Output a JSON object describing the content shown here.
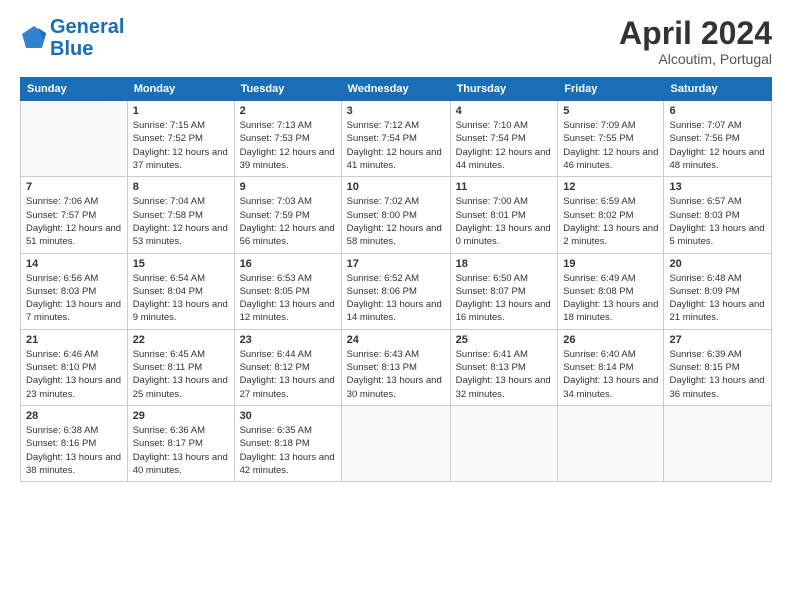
{
  "header": {
    "logo_line1": "General",
    "logo_line2": "Blue",
    "month_title": "April 2024",
    "subtitle": "Alcoutim, Portugal"
  },
  "weekdays": [
    "Sunday",
    "Monday",
    "Tuesday",
    "Wednesday",
    "Thursday",
    "Friday",
    "Saturday"
  ],
  "weeks": [
    [
      {
        "day": "",
        "sunrise": "",
        "sunset": "",
        "daylight": ""
      },
      {
        "day": "1",
        "sunrise": "Sunrise: 7:15 AM",
        "sunset": "Sunset: 7:52 PM",
        "daylight": "Daylight: 12 hours and 37 minutes."
      },
      {
        "day": "2",
        "sunrise": "Sunrise: 7:13 AM",
        "sunset": "Sunset: 7:53 PM",
        "daylight": "Daylight: 12 hours and 39 minutes."
      },
      {
        "day": "3",
        "sunrise": "Sunrise: 7:12 AM",
        "sunset": "Sunset: 7:54 PM",
        "daylight": "Daylight: 12 hours and 41 minutes."
      },
      {
        "day": "4",
        "sunrise": "Sunrise: 7:10 AM",
        "sunset": "Sunset: 7:54 PM",
        "daylight": "Daylight: 12 hours and 44 minutes."
      },
      {
        "day": "5",
        "sunrise": "Sunrise: 7:09 AM",
        "sunset": "Sunset: 7:55 PM",
        "daylight": "Daylight: 12 hours and 46 minutes."
      },
      {
        "day": "6",
        "sunrise": "Sunrise: 7:07 AM",
        "sunset": "Sunset: 7:56 PM",
        "daylight": "Daylight: 12 hours and 48 minutes."
      }
    ],
    [
      {
        "day": "7",
        "sunrise": "Sunrise: 7:06 AM",
        "sunset": "Sunset: 7:57 PM",
        "daylight": "Daylight: 12 hours and 51 minutes."
      },
      {
        "day": "8",
        "sunrise": "Sunrise: 7:04 AM",
        "sunset": "Sunset: 7:58 PM",
        "daylight": "Daylight: 12 hours and 53 minutes."
      },
      {
        "day": "9",
        "sunrise": "Sunrise: 7:03 AM",
        "sunset": "Sunset: 7:59 PM",
        "daylight": "Daylight: 12 hours and 56 minutes."
      },
      {
        "day": "10",
        "sunrise": "Sunrise: 7:02 AM",
        "sunset": "Sunset: 8:00 PM",
        "daylight": "Daylight: 12 hours and 58 minutes."
      },
      {
        "day": "11",
        "sunrise": "Sunrise: 7:00 AM",
        "sunset": "Sunset: 8:01 PM",
        "daylight": "Daylight: 13 hours and 0 minutes."
      },
      {
        "day": "12",
        "sunrise": "Sunrise: 6:59 AM",
        "sunset": "Sunset: 8:02 PM",
        "daylight": "Daylight: 13 hours and 2 minutes."
      },
      {
        "day": "13",
        "sunrise": "Sunrise: 6:57 AM",
        "sunset": "Sunset: 8:03 PM",
        "daylight": "Daylight: 13 hours and 5 minutes."
      }
    ],
    [
      {
        "day": "14",
        "sunrise": "Sunrise: 6:56 AM",
        "sunset": "Sunset: 8:03 PM",
        "daylight": "Daylight: 13 hours and 7 minutes."
      },
      {
        "day": "15",
        "sunrise": "Sunrise: 6:54 AM",
        "sunset": "Sunset: 8:04 PM",
        "daylight": "Daylight: 13 hours and 9 minutes."
      },
      {
        "day": "16",
        "sunrise": "Sunrise: 6:53 AM",
        "sunset": "Sunset: 8:05 PM",
        "daylight": "Daylight: 13 hours and 12 minutes."
      },
      {
        "day": "17",
        "sunrise": "Sunrise: 6:52 AM",
        "sunset": "Sunset: 8:06 PM",
        "daylight": "Daylight: 13 hours and 14 minutes."
      },
      {
        "day": "18",
        "sunrise": "Sunrise: 6:50 AM",
        "sunset": "Sunset: 8:07 PM",
        "daylight": "Daylight: 13 hours and 16 minutes."
      },
      {
        "day": "19",
        "sunrise": "Sunrise: 6:49 AM",
        "sunset": "Sunset: 8:08 PM",
        "daylight": "Daylight: 13 hours and 18 minutes."
      },
      {
        "day": "20",
        "sunrise": "Sunrise: 6:48 AM",
        "sunset": "Sunset: 8:09 PM",
        "daylight": "Daylight: 13 hours and 21 minutes."
      }
    ],
    [
      {
        "day": "21",
        "sunrise": "Sunrise: 6:46 AM",
        "sunset": "Sunset: 8:10 PM",
        "daylight": "Daylight: 13 hours and 23 minutes."
      },
      {
        "day": "22",
        "sunrise": "Sunrise: 6:45 AM",
        "sunset": "Sunset: 8:11 PM",
        "daylight": "Daylight: 13 hours and 25 minutes."
      },
      {
        "day": "23",
        "sunrise": "Sunrise: 6:44 AM",
        "sunset": "Sunset: 8:12 PM",
        "daylight": "Daylight: 13 hours and 27 minutes."
      },
      {
        "day": "24",
        "sunrise": "Sunrise: 6:43 AM",
        "sunset": "Sunset: 8:13 PM",
        "daylight": "Daylight: 13 hours and 30 minutes."
      },
      {
        "day": "25",
        "sunrise": "Sunrise: 6:41 AM",
        "sunset": "Sunset: 8:13 PM",
        "daylight": "Daylight: 13 hours and 32 minutes."
      },
      {
        "day": "26",
        "sunrise": "Sunrise: 6:40 AM",
        "sunset": "Sunset: 8:14 PM",
        "daylight": "Daylight: 13 hours and 34 minutes."
      },
      {
        "day": "27",
        "sunrise": "Sunrise: 6:39 AM",
        "sunset": "Sunset: 8:15 PM",
        "daylight": "Daylight: 13 hours and 36 minutes."
      }
    ],
    [
      {
        "day": "28",
        "sunrise": "Sunrise: 6:38 AM",
        "sunset": "Sunset: 8:16 PM",
        "daylight": "Daylight: 13 hours and 38 minutes."
      },
      {
        "day": "29",
        "sunrise": "Sunrise: 6:36 AM",
        "sunset": "Sunset: 8:17 PM",
        "daylight": "Daylight: 13 hours and 40 minutes."
      },
      {
        "day": "30",
        "sunrise": "Sunrise: 6:35 AM",
        "sunset": "Sunset: 8:18 PM",
        "daylight": "Daylight: 13 hours and 42 minutes."
      },
      {
        "day": "",
        "sunrise": "",
        "sunset": "",
        "daylight": ""
      },
      {
        "day": "",
        "sunrise": "",
        "sunset": "",
        "daylight": ""
      },
      {
        "day": "",
        "sunrise": "",
        "sunset": "",
        "daylight": ""
      },
      {
        "day": "",
        "sunrise": "",
        "sunset": "",
        "daylight": ""
      }
    ]
  ]
}
